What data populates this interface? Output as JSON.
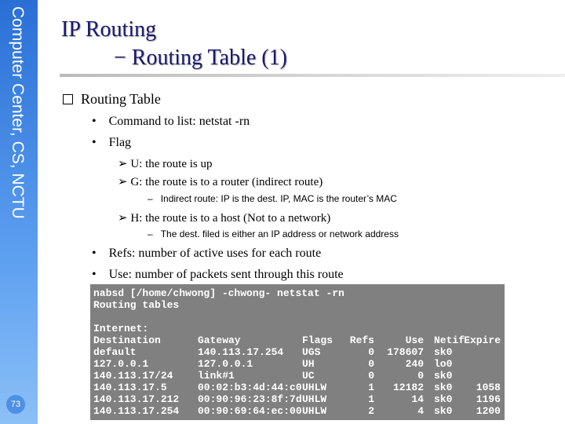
{
  "sidebar": {
    "text": "Computer Center, CS, NCTU",
    "page": "73"
  },
  "title": {
    "line1": "IP Routing",
    "line2": "− Routing Table (1)"
  },
  "content": {
    "heading": "Routing Table",
    "b1": "Command to list: netstat -rn",
    "b2": "Flag",
    "f_u": "U: the route is up",
    "f_g": "G: the route is to a router (indirect route)",
    "f_g_sub": "Indirect route: IP is the dest. IP, MAC is the router’s MAC",
    "f_h": "H: the route is to a host (Not to a network)",
    "f_h_sub": "The dest. filed is either an IP address or network address",
    "b3": "Refs: number of active uses for each route",
    "b4": "Use: number of packets sent through this route"
  },
  "terminal": {
    "prompt": "nabsd [/home/chwong] -chwong- netstat -rn",
    "line2": "Routing tables",
    "section": "Internet:",
    "headers": [
      "Destination",
      "Gateway",
      "Flags",
      "Refs",
      "Use",
      "Netif",
      "Expire"
    ],
    "rows": [
      [
        "default",
        "140.113.17.254",
        "UGS",
        "0",
        "178607",
        "sk0",
        ""
      ],
      [
        "127.0.0.1",
        "127.0.0.1",
        "UH",
        "0",
        "240",
        "lo0",
        ""
      ],
      [
        "140.113.17/24",
        "link#1",
        "UC",
        "0",
        "0",
        "sk0",
        ""
      ],
      [
        "140.113.17.5",
        "00:02:b3:4d:44:c0",
        "UHLW",
        "1",
        "12182",
        "sk0",
        "1058"
      ],
      [
        "140.113.17.212",
        "00:90:96:23:8f:7d",
        "UHLW",
        "1",
        "14",
        "sk0",
        "1196"
      ],
      [
        "140.113.17.254",
        "00:90:69:64:ec:00",
        "UHLW",
        "2",
        "4",
        "sk0",
        "1200"
      ]
    ]
  }
}
